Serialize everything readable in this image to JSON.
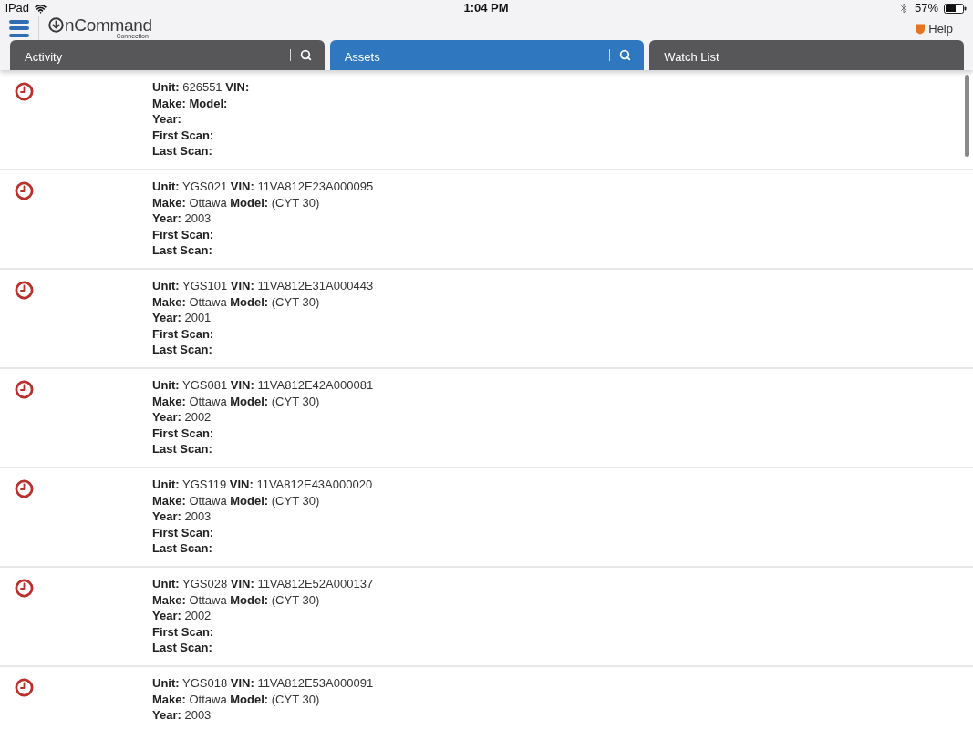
{
  "status_bar": {
    "device": "iPad",
    "time": "1:04 PM",
    "battery": "57%"
  },
  "header": {
    "logo": {
      "name": "nCommand",
      "sub": "Connection"
    },
    "help": "Help"
  },
  "tabs": [
    {
      "label": "Activity",
      "selected": false,
      "has_search": true
    },
    {
      "label": "Assets",
      "selected": true,
      "has_search": true
    },
    {
      "label": "Watch List",
      "selected": false,
      "has_search": false
    }
  ],
  "assets": [
    {
      "lines": [
        [
          {
            "label": "Unit:",
            "value": "626551"
          },
          {
            "label": "VIN:"
          }
        ],
        [
          {
            "label": "Make:"
          },
          {
            "label": "Model:"
          }
        ],
        [
          {
            "label": "Year:"
          }
        ],
        [
          {
            "label": "First Scan:"
          }
        ],
        [
          {
            "label": "Last Scan:"
          }
        ]
      ]
    },
    {
      "lines": [
        [
          {
            "label": "Unit:",
            "value": "YGS021"
          },
          {
            "label": "VIN:",
            "value": "11VA812E23A000095"
          }
        ],
        [
          {
            "label": "Make:",
            "value": "Ottawa"
          },
          {
            "label": "Model:",
            "value": "(CYT 30)"
          }
        ],
        [
          {
            "label": "Year:",
            "value": "2003"
          }
        ],
        [
          {
            "label": "First Scan:"
          }
        ],
        [
          {
            "label": "Last Scan:"
          }
        ]
      ]
    },
    {
      "lines": [
        [
          {
            "label": "Unit:",
            "value": "YGS101"
          },
          {
            "label": "VIN:",
            "value": "11VA812E31A000443"
          }
        ],
        [
          {
            "label": "Make:",
            "value": "Ottawa"
          },
          {
            "label": "Model:",
            "value": "(CYT 30)"
          }
        ],
        [
          {
            "label": "Year:",
            "value": "2001"
          }
        ],
        [
          {
            "label": "First Scan:"
          }
        ],
        [
          {
            "label": "Last Scan:"
          }
        ]
      ]
    },
    {
      "lines": [
        [
          {
            "label": "Unit:",
            "value": "YGS081"
          },
          {
            "label": "VIN:",
            "value": "11VA812E42A000081"
          }
        ],
        [
          {
            "label": "Make:",
            "value": "Ottawa"
          },
          {
            "label": "Model:",
            "value": "(CYT 30)"
          }
        ],
        [
          {
            "label": "Year:",
            "value": "2002"
          }
        ],
        [
          {
            "label": "First Scan:"
          }
        ],
        [
          {
            "label": "Last Scan:"
          }
        ]
      ]
    },
    {
      "lines": [
        [
          {
            "label": "Unit:",
            "value": "YGS119"
          },
          {
            "label": "VIN:",
            "value": "11VA812E43A000020"
          }
        ],
        [
          {
            "label": "Make:",
            "value": "Ottawa"
          },
          {
            "label": "Model:",
            "value": "(CYT 30)"
          }
        ],
        [
          {
            "label": "Year:",
            "value": "2003"
          }
        ],
        [
          {
            "label": "First Scan:"
          }
        ],
        [
          {
            "label": "Last Scan:"
          }
        ]
      ]
    },
    {
      "lines": [
        [
          {
            "label": "Unit:",
            "value": "YGS028"
          },
          {
            "label": "VIN:",
            "value": "11VA812E52A000137"
          }
        ],
        [
          {
            "label": "Make:",
            "value": "Ottawa"
          },
          {
            "label": "Model:",
            "value": "(CYT 30)"
          }
        ],
        [
          {
            "label": "Year:",
            "value": "2002"
          }
        ],
        [
          {
            "label": "First Scan:"
          }
        ],
        [
          {
            "label": "Last Scan:"
          }
        ]
      ]
    },
    {
      "lines": [
        [
          {
            "label": "Unit:",
            "value": "YGS018"
          },
          {
            "label": "VIN:",
            "value": "11VA812E53A000091"
          }
        ],
        [
          {
            "label": "Make:",
            "value": "Ottawa"
          },
          {
            "label": "Model:",
            "value": "(CYT 30)"
          }
        ],
        [
          {
            "label": "Year:",
            "value": "2003"
          }
        ]
      ]
    }
  ]
}
